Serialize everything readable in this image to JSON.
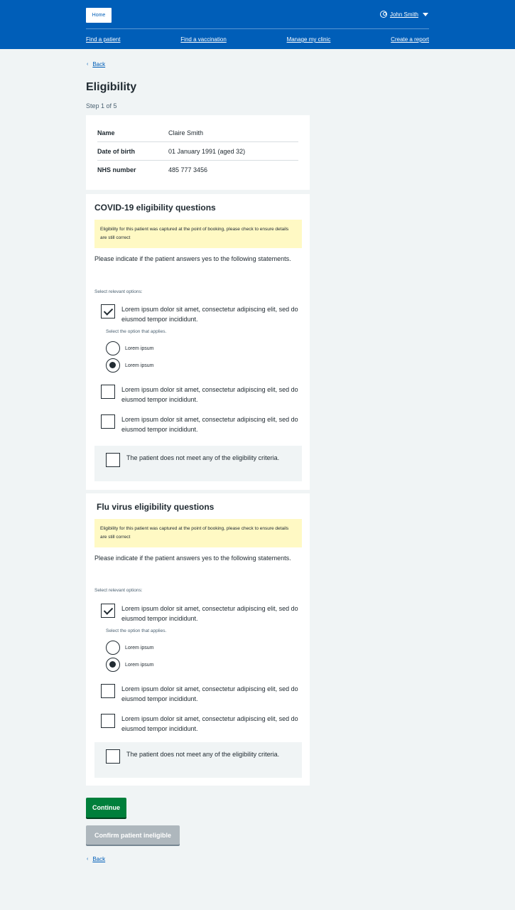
{
  "header": {
    "home_label": "Home",
    "user_name": "John Smith",
    "nav": [
      "Find a patient",
      "Find a vaccination",
      "Manage my clinic",
      "Create a report"
    ]
  },
  "back_label": "Back",
  "page_title": "Eligibility",
  "step": "Step 1 of 5",
  "patient": {
    "rows": [
      {
        "key": "Name",
        "value": "Claire Smith"
      },
      {
        "key": "Date of birth",
        "value": "01 January 1991 (aged 32)"
      },
      {
        "key": "NHS number",
        "value": "485 777 3456"
      }
    ]
  },
  "sections": [
    {
      "title": "COVID-19 eligibility questions",
      "warning": "Eligibility for this patient was captured at the point of booking, please check to ensure details are still correct",
      "intro": "Please indicate if the patient answers yes to the following statements.",
      "hint": "Select relevant options:",
      "options": [
        {
          "label": "Lorem ipsum dolor sit amet, consectetur adipiscing elit, sed do eiusmod tempor incididunt.",
          "checked": true
        },
        {
          "label": "Lorem ipsum dolor sit amet, consectetur adipiscing elit, sed do eiusmod tempor incididunt.",
          "checked": false
        },
        {
          "label": "Lorem ipsum dolor sit amet, consectetur adipiscing elit, sed do eiusmod tempor incididunt.",
          "checked": false
        }
      ],
      "sub_hint": "Select the option that applies.",
      "radios": [
        {
          "label": "Lorem ipsum",
          "selected": false
        },
        {
          "label": "Lorem ipsum",
          "selected": true
        }
      ],
      "none_option": "The patient does not meet any of the eligibility criteria."
    },
    {
      "title": "Flu virus eligibility questions",
      "warning": "Eligibility for this patient was captured at the point of booking, please check to ensure details are still correct",
      "intro": "Please indicate if the patient answers yes to the following statements.",
      "hint": "Select relevant options:",
      "options": [
        {
          "label": "Lorem ipsum dolor sit amet, consectetur adipiscing elit, sed do eiusmod tempor incididunt.",
          "checked": true
        },
        {
          "label": "Lorem ipsum dolor sit amet, consectetur adipiscing elit, sed do eiusmod tempor incididunt.",
          "checked": false
        },
        {
          "label": "Lorem ipsum dolor sit amet, consectetur adipiscing elit, sed do eiusmod tempor incididunt.",
          "checked": false
        }
      ],
      "sub_hint": "Select the option that applies.",
      "radios": [
        {
          "label": "Lorem ipsum",
          "selected": false
        },
        {
          "label": "Lorem ipsum",
          "selected": true
        }
      ],
      "none_option": "The patient does not meet any of the eligibility criteria."
    }
  ],
  "buttons": {
    "continue": "Continue",
    "ineligible": "Confirm patient ineligible"
  },
  "colors": {
    "header_blue": "#005eb8",
    "continue_green": "#007f3b",
    "warning_yellow": "#fff9c4",
    "disabled_grey": "#aeb7bd"
  }
}
